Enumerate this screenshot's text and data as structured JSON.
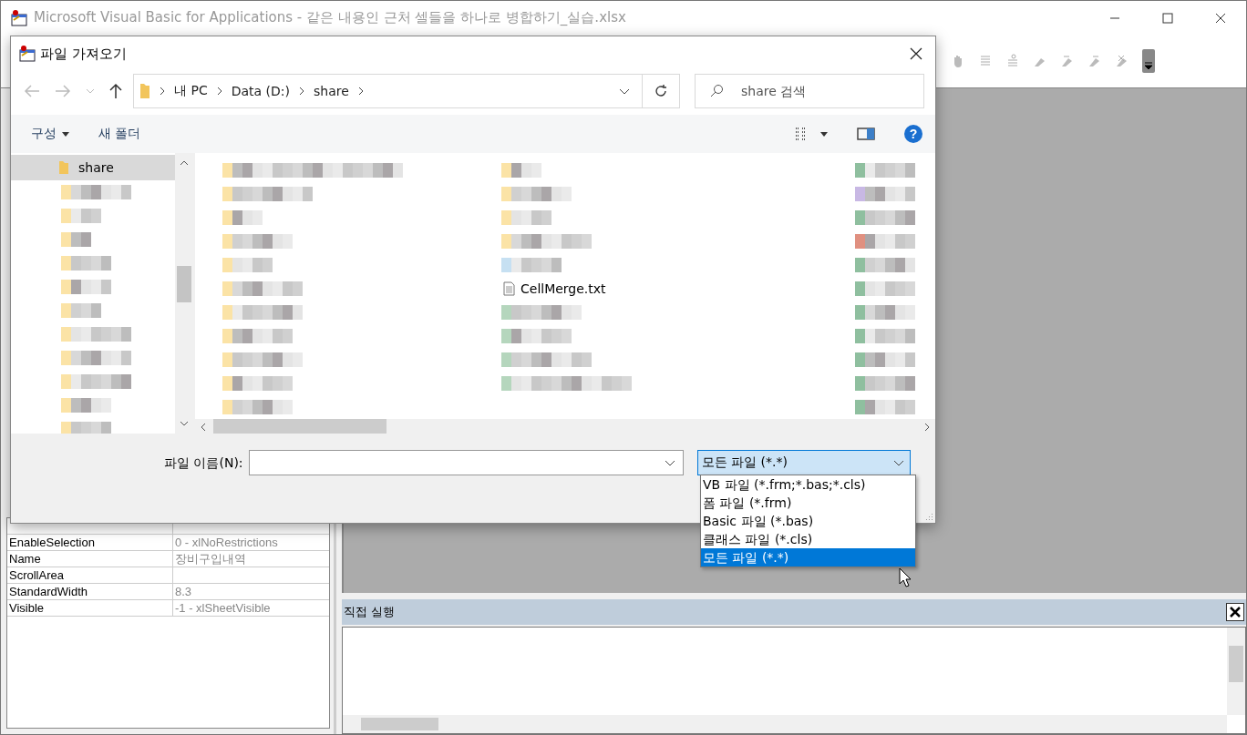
{
  "window": {
    "title": "Microsoft Visual Basic for Applications - 같은 내용인 근처 셀들을 하나로 병합하기_실습.xlsx"
  },
  "properties": [
    {
      "name": "EnableSelection",
      "value": "0 - xlNoRestrictions"
    },
    {
      "name": "Name",
      "value": "장비구입내역"
    },
    {
      "name": "ScrollArea"
    },
    {
      "name": "StandardWidth",
      "value": "8.3"
    },
    {
      "name": "Visible",
      "value": "-1 - xlSheetVisible"
    }
  ],
  "immediate": {
    "title": "직접 실행"
  },
  "dialog": {
    "title": "파일 가져오기",
    "breadcrumb": [
      "내 PC",
      "Data (D:)",
      "share"
    ],
    "search": {
      "placeholder": "share 검색"
    },
    "toolbar": [
      {
        "label": "구성",
        "kind": "menu"
      },
      {
        "label": "새 폴더",
        "kind": "button"
      }
    ],
    "help": "?",
    "tree": [
      {
        "label": "share",
        "selected": true
      }
    ],
    "files": [
      {
        "name": "CellMerge.txt"
      }
    ],
    "filename": {
      "label": "파일 이름(N):"
    },
    "filter": {
      "value": "모든 파일 (*.*)",
      "options": [
        {
          "label": "VB 파일 (*.frm;*.bas;*.cls)",
          "selected": false
        },
        {
          "label": "폼 파일 (*.frm)",
          "selected": false
        },
        {
          "label": "Basic 파일 (*.bas)",
          "selected": false
        },
        {
          "label": "클래스 파일 (*.cls)",
          "selected": false
        },
        {
          "label": "모든 파일 (*.*)",
          "selected": true
        }
      ]
    }
  }
}
